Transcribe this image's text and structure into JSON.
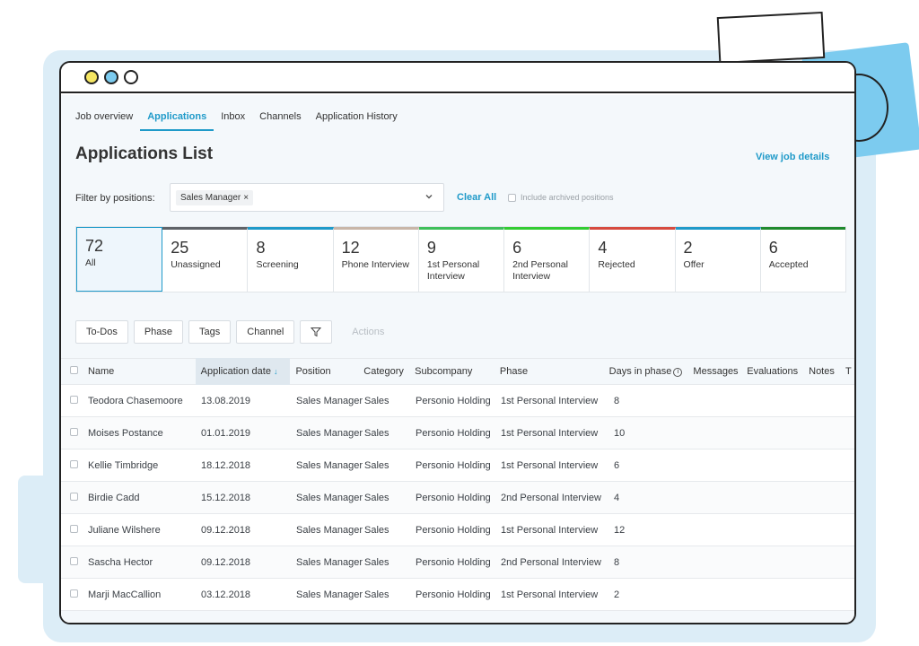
{
  "tabs": [
    {
      "label": "Job overview",
      "active": false
    },
    {
      "label": "Applications",
      "active": true
    },
    {
      "label": "Inbox",
      "active": false
    },
    {
      "label": "Channels",
      "active": false
    },
    {
      "label": "Application History",
      "active": false
    }
  ],
  "page_title": "Applications List",
  "view_job_details": "View job details",
  "filter": {
    "label": "Filter by positions:",
    "selected_chip": "Sales Manager",
    "chip_remove": "×",
    "clear_all": "Clear All",
    "include_archived": "Include archived positions"
  },
  "phases": [
    {
      "count": "72",
      "label": "All",
      "color": "#ffffff",
      "selected": true
    },
    {
      "count": "25",
      "label": "Unassigned",
      "color": "#5f6368"
    },
    {
      "count": "8",
      "label": "Screening",
      "color": "#1f9ac9"
    },
    {
      "count": "12",
      "label": "Phone Interview",
      "color": "#c8b6a8"
    },
    {
      "count": "9",
      "label": "1st Personal Interview",
      "color": "#3fbf5a"
    },
    {
      "count": "6",
      "label": "2nd Personal Interview",
      "color": "#33cc33"
    },
    {
      "count": "4",
      "label": "Rejected",
      "color": "#d64b3f"
    },
    {
      "count": "2",
      "label": "Offer",
      "color": "#1f9ac9"
    },
    {
      "count": "6",
      "label": "Accepted",
      "color": "#1f8a2e"
    }
  ],
  "buttons": {
    "todos": "To-Dos",
    "phase": "Phase",
    "tags": "Tags",
    "channel": "Channel",
    "actions": "Actions"
  },
  "table": {
    "headers": {
      "name": "Name",
      "date": "Application date",
      "position": "Position",
      "category": "Category",
      "subcompany": "Subcompany",
      "phase": "Phase",
      "days": "Days in phase",
      "messages": "Messages",
      "evaluations": "Evaluations",
      "notes": "Notes",
      "t": "T"
    },
    "rows": [
      {
        "name": "Teodora Chasemoore",
        "date": "13.08.2019",
        "position": "Sales Manager",
        "category": "Sales",
        "subcompany": "Personio Holding",
        "phase": "1st Personal Interview",
        "days": "8"
      },
      {
        "name": "Moises Postance",
        "date": "01.01.2019",
        "position": "Sales Manager",
        "category": "Sales",
        "subcompany": "Personio Holding",
        "phase": "1st Personal Interview",
        "days": "10"
      },
      {
        "name": "Kellie Timbridge",
        "date": "18.12.2018",
        "position": "Sales Manager",
        "category": "Sales",
        "subcompany": "Personio Holding",
        "phase": "1st Personal Interview",
        "days": "6"
      },
      {
        "name": "Birdie Cadd",
        "date": "15.12.2018",
        "position": "Sales Manager",
        "category": "Sales",
        "subcompany": "Personio Holding",
        "phase": "2nd Personal Interview",
        "days": "4"
      },
      {
        "name": "Juliane Wilshere",
        "date": "09.12.2018",
        "position": "Sales Manager",
        "category": "Sales",
        "subcompany": "Personio Holding",
        "phase": "1st Personal Interview",
        "days": "12"
      },
      {
        "name": "Sascha Hector",
        "date": "09.12.2018",
        "position": "Sales Manager",
        "category": "Sales",
        "subcompany": "Personio Holding",
        "phase": "2nd Personal Interview",
        "days": "8"
      },
      {
        "name": "Marji MacCallion",
        "date": "03.12.2018",
        "position": "Sales Manager",
        "category": "Sales",
        "subcompany": "Personio Holding",
        "phase": "1st Personal Interview",
        "days": "2"
      }
    ]
  },
  "window_dots": [
    "#f5e663",
    "#7ccbef",
    "#ffffff"
  ]
}
